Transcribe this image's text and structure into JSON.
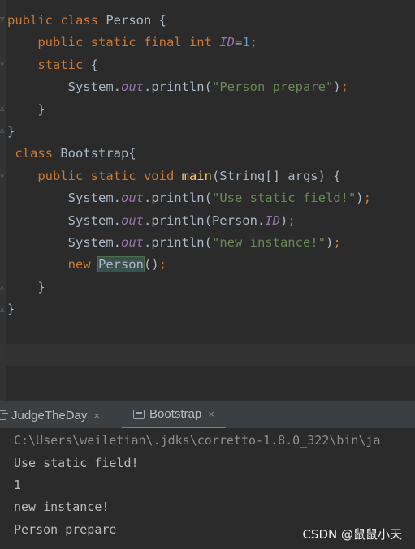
{
  "editor": {
    "lines": [
      [
        [
          "kw",
          "public class "
        ],
        [
          "cls",
          "Person {"
        ]
      ],
      [
        [
          "pl",
          "    "
        ],
        [
          "kw",
          "public static final int "
        ],
        [
          "st",
          "ID"
        ],
        [
          "pl",
          "="
        ],
        [
          "num",
          "1"
        ],
        [
          "kw",
          ";"
        ]
      ],
      [
        [
          "pl",
          "    "
        ],
        [
          "kw",
          "static "
        ],
        [
          "pl",
          "{"
        ]
      ],
      [
        [
          "pl",
          "        System."
        ],
        [
          "st",
          "out"
        ],
        [
          "pl",
          ".println("
        ],
        [
          "str",
          "\"Person prepare\""
        ],
        [
          "pl",
          ")"
        ],
        [
          "kw",
          ";"
        ]
      ],
      [
        [
          "pl",
          "    }"
        ]
      ],
      [
        [
          "pl",
          "}"
        ]
      ],
      [
        [
          "kw",
          " class "
        ],
        [
          "cls",
          "Bootstrap{"
        ]
      ],
      [
        [
          "pl",
          "    "
        ],
        [
          "kw",
          "public static void "
        ],
        [
          "fn",
          "main"
        ],
        [
          "pl",
          "(String[] args) {"
        ]
      ],
      [
        [
          "pl",
          "        System."
        ],
        [
          "st",
          "out"
        ],
        [
          "pl",
          ".println("
        ],
        [
          "str",
          "\"Use static field!\""
        ],
        [
          "pl",
          ")"
        ],
        [
          "kw",
          ";"
        ]
      ],
      [
        [
          "pl",
          "        System."
        ],
        [
          "st",
          "out"
        ],
        [
          "pl",
          ".println(Person."
        ],
        [
          "st",
          "ID"
        ],
        [
          "pl",
          ")"
        ],
        [
          "kw",
          ";"
        ]
      ],
      [
        [
          "pl",
          "        System."
        ],
        [
          "st",
          "out"
        ],
        [
          "pl",
          ".println("
        ],
        [
          "str",
          "\"new instance!\""
        ],
        [
          "pl",
          ")"
        ],
        [
          "kw",
          ";"
        ]
      ],
      [
        [
          "pl",
          "        "
        ],
        [
          "kw",
          "new "
        ],
        [
          "hl",
          "Person"
        ],
        [
          "pl",
          "()"
        ],
        [
          "kw",
          ";"
        ]
      ],
      [
        [
          "pl",
          "    }"
        ]
      ],
      [
        [
          "pl",
          "}"
        ]
      ]
    ]
  },
  "run_tabs": [
    {
      "label": "JudgeTheDay",
      "close": "×"
    },
    {
      "label": "Bootstrap",
      "close": "×"
    }
  ],
  "console": {
    "command": "C:\\Users\\weiletian\\.jdks\\corretto-1.8.0_322\\bin\\ja",
    "output": [
      "Use static field!",
      "1",
      "new instance!",
      "Person prepare"
    ]
  },
  "watermark": "CSDN @鼠鼠小天"
}
